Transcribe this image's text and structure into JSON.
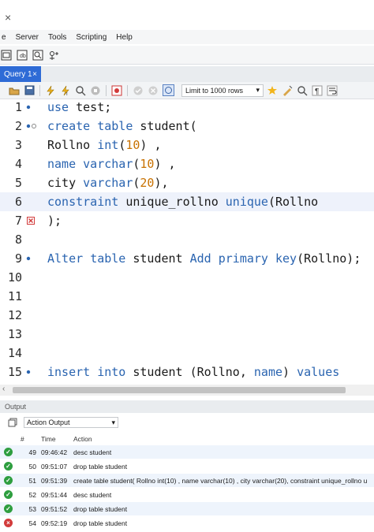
{
  "window": {
    "close_glyph": "×"
  },
  "menu": [
    "e",
    "Server",
    "Tools",
    "Scripting",
    "Help"
  ],
  "tabs": [
    {
      "label": "Query 1",
      "close": "×"
    }
  ],
  "sql_toolbar": {
    "limit_label": "Limit to 1000 rows"
  },
  "editor": {
    "lines": [
      {
        "n": "1",
        "marker": "dot",
        "html": "<span class=\"kw\">use</span> test;"
      },
      {
        "n": "2",
        "marker": "dot-fold",
        "html": "<span class=\"kw\">create</span> <span class=\"kw\">table</span> student("
      },
      {
        "n": "3",
        "marker": "",
        "html": "Rollno <span class=\"kw\">int</span>(<span class=\"num\">10</span>) ,"
      },
      {
        "n": "4",
        "marker": "",
        "html": "<span class=\"kw\">name</span> <span class=\"kw\">varchar</span>(<span class=\"num\">10</span>) ,"
      },
      {
        "n": "5",
        "marker": "",
        "html": "city <span class=\"kw\">varchar</span>(<span class=\"num\">20</span>),"
      },
      {
        "n": "6",
        "marker": "",
        "html": "<span class=\"kw\">constraint</span> unique_rollno <span class=\"kw\">unique</span>(Rollno"
      },
      {
        "n": "7",
        "marker": "error",
        "html": ");"
      },
      {
        "n": "8",
        "marker": "",
        "html": ""
      },
      {
        "n": "9",
        "marker": "dot",
        "html": "<span class=\"kw\">Alter</span> <span class=\"kw\">table</span> student <span class=\"kw\">Add</span> <span class=\"kw\">primary</span> <span class=\"kw\">key</span>(Rollno);"
      },
      {
        "n": "10",
        "marker": "",
        "html": ""
      },
      {
        "n": "11",
        "marker": "",
        "html": ""
      },
      {
        "n": "12",
        "marker": "",
        "html": ""
      },
      {
        "n": "13",
        "marker": "",
        "html": ""
      },
      {
        "n": "14",
        "marker": "",
        "html": ""
      },
      {
        "n": "15",
        "marker": "dot",
        "html": "<span class=\"kw\">insert</span> <span class=\"kw\">into</span> student (Rollno, <span class=\"kw\">name</span>) <span class=\"kw\">values</span>"
      }
    ]
  },
  "output": {
    "title": "Output",
    "selector": "Action Output",
    "columns": {
      "num": "#",
      "time": "Time",
      "action": "Action"
    },
    "rows": [
      {
        "status": "ok",
        "num": "49",
        "time": "09:46:42",
        "action": "desc student"
      },
      {
        "status": "ok",
        "num": "50",
        "time": "09:51:07",
        "action": "drop table student"
      },
      {
        "status": "ok",
        "num": "51",
        "time": "09:51:39",
        "action": "create table student( Rollno int(10) , name varchar(10) , city varchar(20), constraint unique_rollno u"
      },
      {
        "status": "ok",
        "num": "52",
        "time": "09:51:44",
        "action": "desc student"
      },
      {
        "status": "ok",
        "num": "53",
        "time": "09:51:52",
        "action": "drop table student"
      },
      {
        "status": "err",
        "num": "54",
        "time": "09:52:19",
        "action": "drop table student"
      }
    ]
  },
  "colors": {
    "keyword": "#2a64b0",
    "number": "#c87100",
    "tab": "#2e6bd6",
    "ok": "#2e9e3f",
    "error": "#d23b3b"
  }
}
